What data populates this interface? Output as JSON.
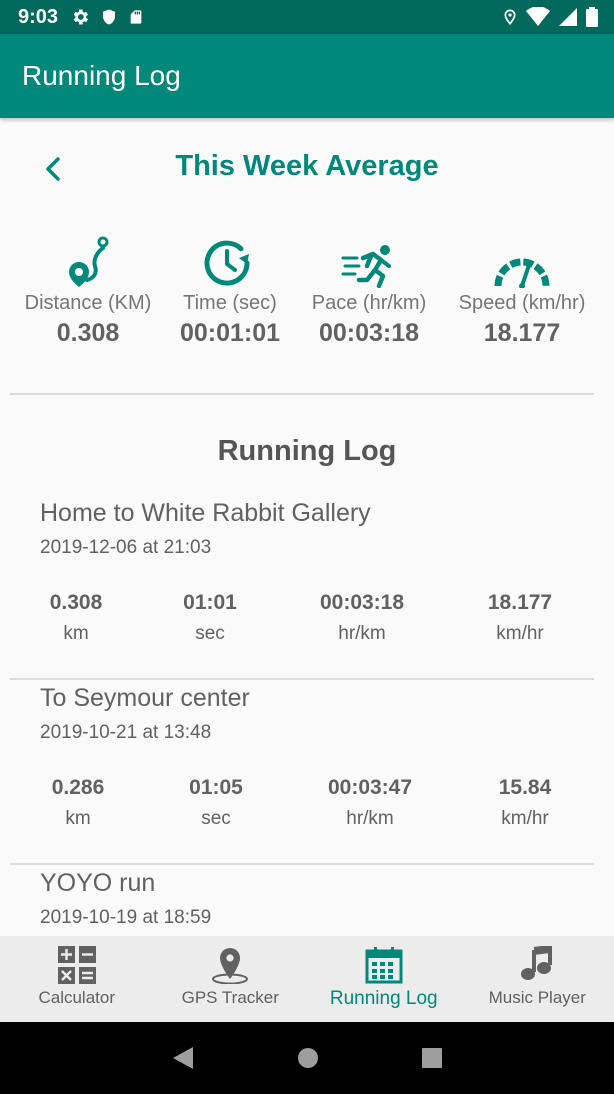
{
  "status_bar": {
    "time": "9:03",
    "left_icons": [
      "gear-icon",
      "shield-icon",
      "sd-card-icon"
    ],
    "right_icons": [
      "location-icon",
      "wifi-icon",
      "signal-icon",
      "battery-icon"
    ]
  },
  "app_bar": {
    "title": "Running Log"
  },
  "week_average": {
    "title": "This Week Average",
    "back_icon": "chevron-left-icon",
    "stats": [
      {
        "icon": "route-pin-icon",
        "label": "Distance (KM)",
        "value": "0.308"
      },
      {
        "icon": "clock-icon",
        "label": "Time (sec)",
        "value": "00:01:01"
      },
      {
        "icon": "runner-icon",
        "label": "Pace (hr/km)",
        "value": "00:03:18"
      },
      {
        "icon": "speedometer-icon",
        "label": "Speed (km/hr)",
        "value": "18.177"
      }
    ]
  },
  "running_log": {
    "title": "Running Log",
    "entries": [
      {
        "name": "Home to White Rabbit Gallery",
        "date": "2019-12-06 at 21:03",
        "metrics": [
          {
            "value": "0.308",
            "unit": "km"
          },
          {
            "value": "01:01",
            "unit": "sec"
          },
          {
            "value": "00:03:18",
            "unit": "hr/km"
          },
          {
            "value": "18.177",
            "unit": "km/hr"
          }
        ]
      },
      {
        "name": "To Seymour center",
        "date": "2019-10-21 at 13:48",
        "metrics": [
          {
            "value": "0.286",
            "unit": "km"
          },
          {
            "value": "01:05",
            "unit": "sec"
          },
          {
            "value": "00:03:47",
            "unit": "hr/km"
          },
          {
            "value": "15.84",
            "unit": "km/hr"
          }
        ]
      },
      {
        "name": "YOYO run",
        "date": "2019-10-19 at 18:59",
        "metrics": []
      }
    ]
  },
  "bottom_nav": {
    "items": [
      {
        "label": "Calculator",
        "icon": "calculator-icon",
        "active": false
      },
      {
        "label": "GPS Tracker",
        "icon": "map-pin-icon",
        "active": false
      },
      {
        "label": "Running Log",
        "icon": "calendar-icon",
        "active": true
      },
      {
        "label": "Music Player",
        "icon": "music-note-icon",
        "active": false
      }
    ]
  },
  "colors": {
    "status_bar": "#00695c",
    "primary": "#00897b",
    "text": "#616161",
    "nav_background": "#ececec"
  }
}
